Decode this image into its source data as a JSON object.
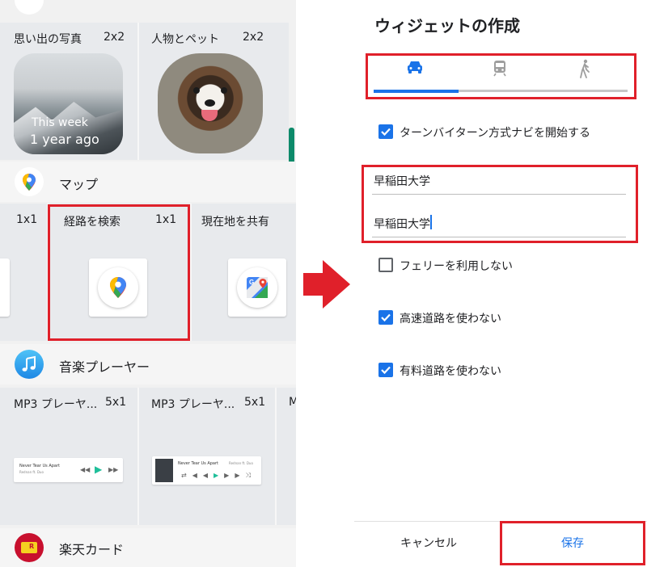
{
  "left": {
    "photo_widgets": [
      {
        "title": "思い出の写真",
        "size": "2x2",
        "overlay_line1": "This week",
        "overlay_line2": "1 year ago"
      },
      {
        "title": "人物とペット",
        "size": "2x2"
      }
    ],
    "maps": {
      "app_name": "マップ",
      "widgets": [
        {
          "title": "",
          "size": "1x1"
        },
        {
          "title": "経路を検索",
          "size": "1x1"
        },
        {
          "title": "現在地を共有",
          "size": ""
        }
      ]
    },
    "music": {
      "app_name": "音楽プレーヤー",
      "widgets": [
        {
          "title": "MP3 プレーヤ...",
          "size": "5x1",
          "track": "Never Tear Us Apart",
          "artist": "Rednan ft. Duo"
        },
        {
          "title": "MP3 プレーヤ...",
          "size": "5x1",
          "track": "Never Tear Us Apart",
          "artist": "Rednan ft. Duo"
        },
        {
          "title": "M",
          "size": ""
        }
      ]
    },
    "rakuten": {
      "app_name": "楽天カード"
    }
  },
  "dialog": {
    "title": "ウィジェットの作成",
    "modes": [
      {
        "icon": "car-icon",
        "selected": true
      },
      {
        "icon": "train-icon",
        "selected": false
      },
      {
        "icon": "walk-icon",
        "selected": false
      }
    ],
    "options": {
      "turn_by_turn": {
        "label": "ターンバイターン方式ナビを開始する",
        "checked": true
      },
      "avoid_ferries": {
        "label": "フェリーを利用しない",
        "checked": false
      },
      "avoid_highways": {
        "label": "高速道路を使わない",
        "checked": true
      },
      "avoid_tolls": {
        "label": "有料道路を使わない",
        "checked": true
      }
    },
    "fields": {
      "origin": "早稲田大学",
      "destination": "早稲田大学"
    },
    "cancel_label": "キャンセル",
    "save_label": "保存"
  },
  "colors": {
    "accent": "#1a73e8",
    "highlight_box": "#e0202a",
    "arrow": "#e0202a",
    "scrollbar": "#0d8a6a"
  }
}
